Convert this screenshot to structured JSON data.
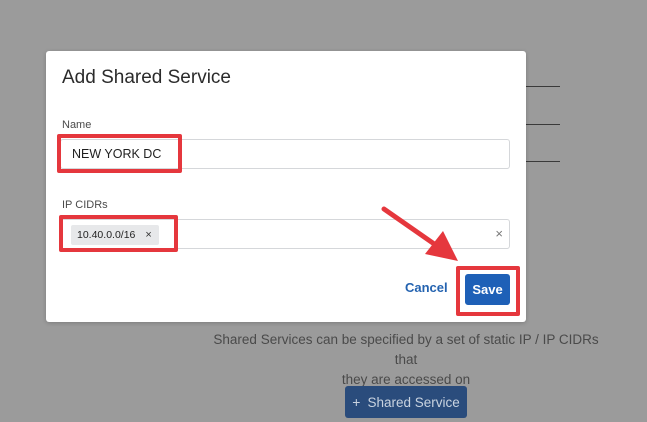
{
  "background": {
    "description_line1": "Shared Services can be specified by a set of static IP / IP CIDRs that",
    "description_line2": "they are accessed on",
    "add_button_icon": "+",
    "add_button_label": "Shared Service"
  },
  "modal": {
    "title": "Add Shared Service",
    "name_label": "Name",
    "name_value": "NEW YORK DC",
    "cidrs_label": "IP CIDRs",
    "cidr_chips": [
      "10.40.0.0/16"
    ],
    "chip_remove_icon": "×",
    "clear_icon": "×",
    "cancel_label": "Cancel",
    "save_label": "Save"
  },
  "annotation_color": "#e5373d"
}
